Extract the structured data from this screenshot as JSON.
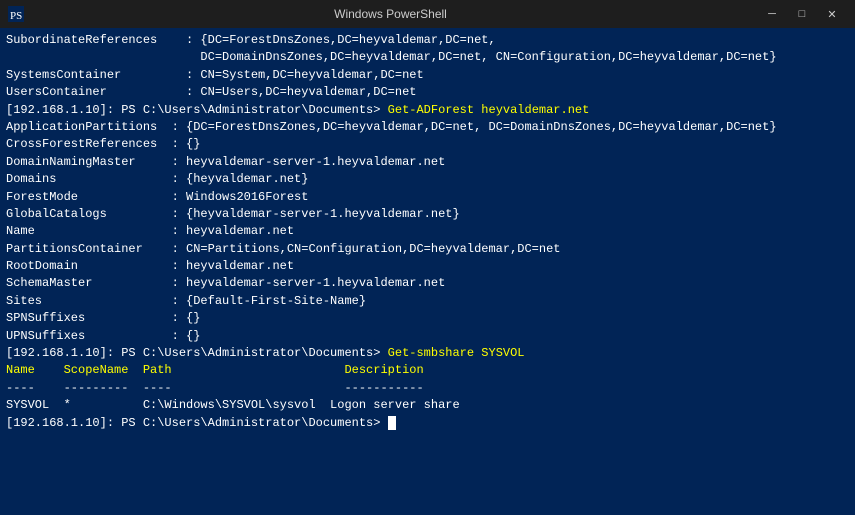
{
  "titleBar": {
    "title": "Windows PowerShell",
    "minimizeLabel": "─",
    "maximizeLabel": "□",
    "closeLabel": "✕"
  },
  "terminal": {
    "lines": [
      {
        "text": "SubordinateReferences    : {DC=ForestDnsZones,DC=heyvaldemar,DC=net,",
        "color": "white"
      },
      {
        "text": "                           DC=DomainDnsZones,DC=heyvaldemar,DC=net, CN=Configuration,DC=heyvaldemar,DC=net}",
        "color": "white"
      },
      {
        "text": "SystemsContainer         : CN=System,DC=heyvaldemar,DC=net",
        "color": "white"
      },
      {
        "text": "UsersContainer           : CN=Users,DC=heyvaldemar,DC=net",
        "color": "white"
      },
      {
        "text": "",
        "color": "white"
      },
      {
        "text": "",
        "color": "white"
      },
      {
        "text": "[192.168.1.10]: PS C:\\Users\\Administrator\\Documents> ",
        "color": "white",
        "cmd": "Get-ADForest heyvaldemar.net"
      },
      {
        "text": "",
        "color": "white"
      },
      {
        "text": "ApplicationPartitions  : {DC=ForestDnsZones,DC=heyvaldemar,DC=net, DC=DomainDnsZones,DC=heyvaldemar,DC=net}",
        "color": "white"
      },
      {
        "text": "CrossForestReferences  : {}",
        "color": "white"
      },
      {
        "text": "DomainNamingMaster     : heyvaldemar-server-1.heyvaldemar.net",
        "color": "white"
      },
      {
        "text": "Domains                : {heyvaldemar.net}",
        "color": "white"
      },
      {
        "text": "ForestMode             : Windows2016Forest",
        "color": "white"
      },
      {
        "text": "GlobalCatalogs         : {heyvaldemar-server-1.heyvaldemar.net}",
        "color": "white"
      },
      {
        "text": "Name                   : heyvaldemar.net",
        "color": "white"
      },
      {
        "text": "PartitionsContainer    : CN=Partitions,CN=Configuration,DC=heyvaldemar,DC=net",
        "color": "white"
      },
      {
        "text": "RootDomain             : heyvaldemar.net",
        "color": "white"
      },
      {
        "text": "SchemaMaster           : heyvaldemar-server-1.heyvaldemar.net",
        "color": "white"
      },
      {
        "text": "Sites                  : {Default-First-Site-Name}",
        "color": "white"
      },
      {
        "text": "SPNSuffixes            : {}",
        "color": "white"
      },
      {
        "text": "UPNSuffixes            : {}",
        "color": "white"
      },
      {
        "text": "",
        "color": "white"
      },
      {
        "text": "",
        "color": "white"
      },
      {
        "text": "[192.168.1.10]: PS C:\\Users\\Administrator\\Documents> ",
        "color": "white",
        "cmd": "Get-smbshare SYSVOL"
      },
      {
        "text": "",
        "color": "white"
      },
      {
        "text": "Name    ScopeName  Path                        Description",
        "color": "yellow"
      },
      {
        "text": "----    ---------  ----                        -----------",
        "color": "white"
      },
      {
        "text": "SYSVOL  *          C:\\Windows\\SYSVOL\\sysvol  Logon server share",
        "color": "white"
      },
      {
        "text": "",
        "color": "white"
      },
      {
        "text": "[192.168.1.10]: PS C:\\Users\\Administrator\\Documents> ",
        "color": "white",
        "cursor": true
      }
    ]
  }
}
